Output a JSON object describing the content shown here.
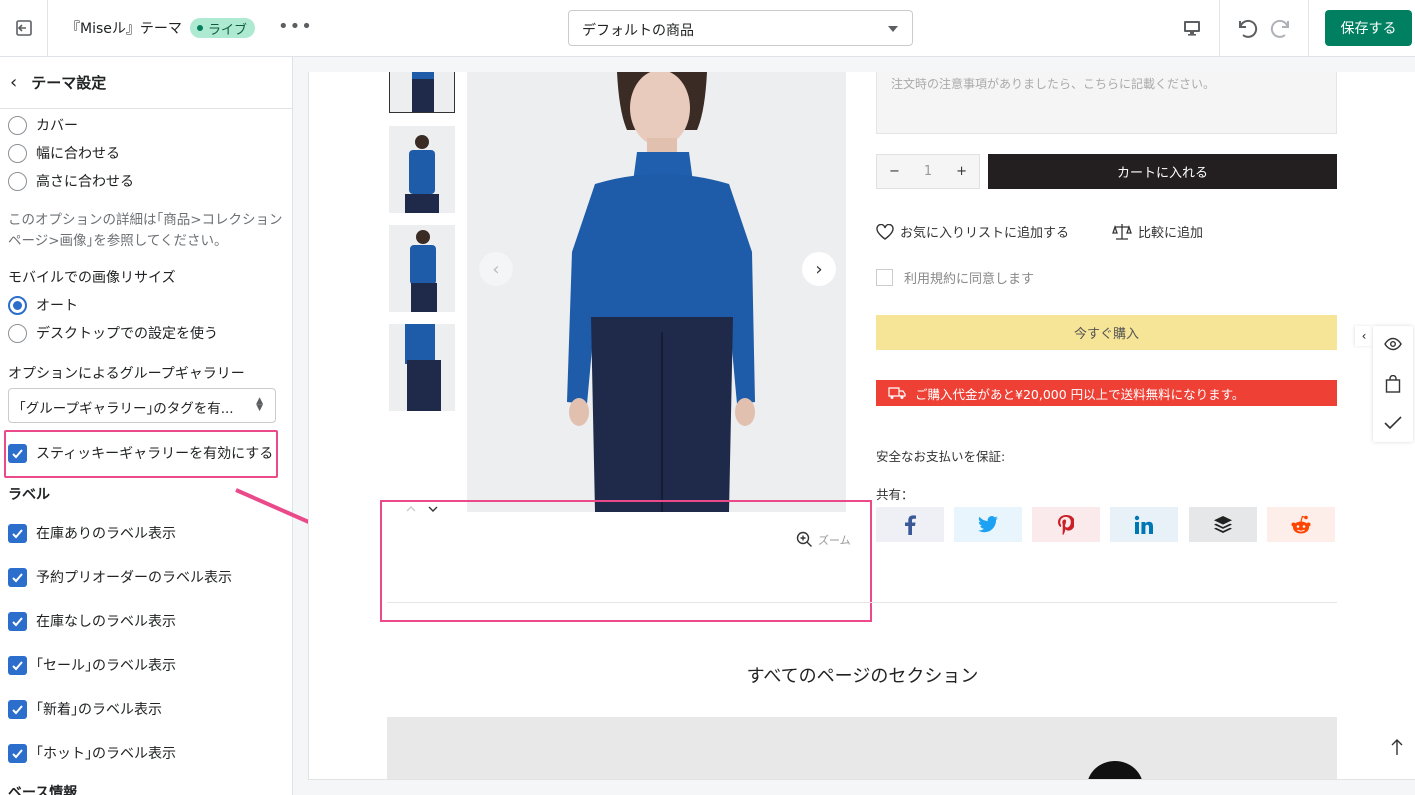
{
  "topbar": {
    "title": "『Miseル』テーマ",
    "live_badge": "ライブ",
    "more": "•••",
    "template_select": "デフォルトの商品",
    "save_label": "保存する"
  },
  "sidebar": {
    "title": "テーマ設定",
    "fit_options": [
      "カバー",
      "幅に合わせる",
      "高さに合わせる"
    ],
    "help_text": "このオプションの詳細は｢商品>コレクションページ>画像｣を参照してください。",
    "mobile_resize_label": "モバイルでの画像リサイズ",
    "mobile_options": [
      "オート",
      "デスクトップでの設定を使う"
    ],
    "mobile_selected": "オート",
    "group_gallery_label": "オプションによるグループギャラリー",
    "group_gallery_value": "｢グループギャラリー｣のタグを有...",
    "sticky_gallery": "スティッキーギャラリーを有効にする",
    "labels_heading": "ラベル",
    "label_options": [
      "在庫ありのラベル表示",
      "予約プリオーダーのラベル表示",
      "在庫なしのラベル表示",
      "｢セール｣のラベル表示",
      "｢新着｣のラベル表示",
      "｢ホット｣のラベル表示"
    ],
    "base_info": "ベース情報"
  },
  "product": {
    "note_placeholder": "注文時の注意事項がありましたら、こちらに記載ください。",
    "qty_minus": "−",
    "qty_value": "1",
    "qty_plus": "+",
    "add_to_cart": "カートに入れる",
    "wishlist": "お気に入りリストに追加する",
    "compare": "比較に追加",
    "terms": "利用規約に同意します",
    "buy_now": "今すぐ購入",
    "shipping_notice": "ご購入代金があと¥20,000 円以上で送料無料になります。",
    "secure_payment": "安全なお支払いを保証:",
    "share_label": "共有：",
    "zoom": "ズーム",
    "section_title": "すべてのページのセクション"
  },
  "colors": {
    "accent": "#008060",
    "highlight": "#ea4a8a",
    "checkbox": "#2c6ecb",
    "buy_now_bg": "#f6e597",
    "shipping_bg": "#ee4035",
    "cart_bg": "#231f20"
  },
  "icons": {
    "exit": "exit-icon",
    "desktop": "desktop-icon",
    "undo": "undo-icon",
    "redo": "redo-icon",
    "social": [
      "facebook-icon",
      "twitter-icon",
      "pinterest-icon",
      "linkedin-icon",
      "buffer-icon",
      "reddit-icon"
    ]
  }
}
